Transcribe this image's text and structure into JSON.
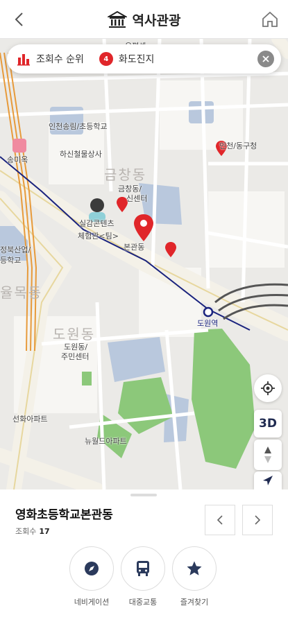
{
  "header": {
    "title": "역사관광"
  },
  "filter": {
    "ranking_label": "조회수 순위",
    "selected_count": "4",
    "selected_label": "화도진지"
  },
  "map": {
    "labels": [
      "인천송림/초등학교",
      "하신철물상사",
      "송미옥",
      "금창동",
      "금창동/",
      "신센터",
      "실감콘텐츠",
      "체험관<팀>",
      "본관동",
      "인천/동구청",
      "정북산업/",
      "등학교",
      "율목동",
      "도원동",
      "도원동/",
      "주민센터",
      "도원역",
      "선화아파트",
      "뉴월드아파트",
      "우편센"
    ],
    "controls": {
      "three_d": "3D"
    }
  },
  "sheet": {
    "place_name": "영화초등학교본관동",
    "views_label": "조회수",
    "views_value": "17",
    "actions": [
      {
        "label": "네비게이션",
        "icon": "compass-icon"
      },
      {
        "label": "대중교통",
        "icon": "bus-icon"
      },
      {
        "label": "즐겨찾기",
        "icon": "star-icon"
      }
    ]
  },
  "colors": {
    "accent_red": "#e0262a",
    "subway_line": "#1a237e",
    "park_green": "#8cc87a",
    "water_blue": "#a8c4e8"
  }
}
